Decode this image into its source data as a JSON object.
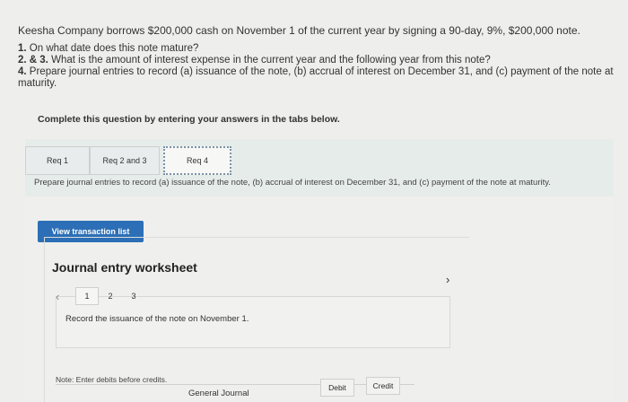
{
  "problem": {
    "intro": "Keesha Company borrows $200,000 cash on November 1 of the current year by signing a 90-day, 9%, $200,000 note.",
    "q1_num": "1.",
    "q1_text": "On what date does this note mature?",
    "q2_num": "2. & 3.",
    "q2_text": "What is the amount of interest expense in the current year and the following year from this note?",
    "q4_num": "4.",
    "q4_text": "Prepare journal entries to record (a) issuance of the note, (b) accrual of interest on December 31, and (c) payment of the note at maturity."
  },
  "instruction": "Complete this question by entering your answers in the tabs below.",
  "tabs": [
    {
      "label": "Req 1"
    },
    {
      "label": "Req 2 and 3"
    },
    {
      "label": "Req 4"
    }
  ],
  "tab_description": "Prepare journal entries to record (a) issuance of the note, (b) accrual of interest on December 31, and (c) payment of the note at maturity.",
  "view_button": "View transaction list",
  "worksheet": {
    "title": "Journal entry worksheet",
    "pages": [
      "1",
      "2",
      "3"
    ],
    "active_page": "1",
    "record_text": "Record the issuance of the note on November 1.",
    "note": "Note: Enter debits before credits.",
    "col_journal": "General Journal",
    "col_debit": "Debit",
    "col_credit": "Credit"
  },
  "icons": {
    "prev": "chevron-left-icon",
    "next": "chevron-right-icon",
    "cursor": "mouse-pointer-icon"
  }
}
